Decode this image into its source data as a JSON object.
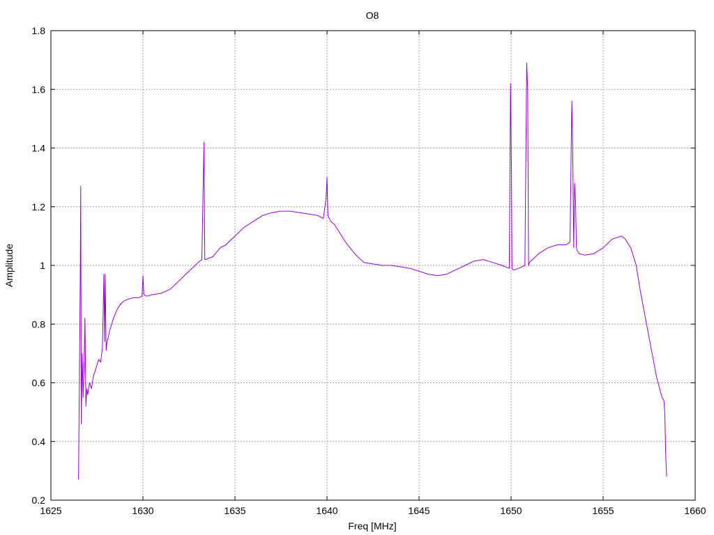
{
  "chart_data": {
    "type": "line",
    "title": "O8",
    "xlabel": "Freq [MHz]",
    "ylabel": "Amplitude",
    "xlim": [
      1625,
      1660
    ],
    "ylim": [
      0.2,
      1.8
    ],
    "xticks": [
      1625,
      1630,
      1635,
      1640,
      1645,
      1650,
      1655,
      1660
    ],
    "xtick_labels": [
      "1625",
      "1630",
      "1635",
      "1640",
      "1645",
      "1650",
      "1655",
      "1660"
    ],
    "yticks": [
      0.2,
      0.4,
      0.6,
      0.8,
      1.0,
      1.2,
      1.4,
      1.6,
      1.8
    ],
    "ytick_labels": [
      "0.2",
      "0.4",
      "0.6",
      "0.8",
      "1",
      "1.2",
      "1.4",
      "1.6",
      "1.8"
    ],
    "grid": true,
    "legend": "none",
    "series": [
      {
        "color": "#9400d3",
        "x": [
          1626.5,
          1626.55,
          1626.6,
          1626.62,
          1626.65,
          1626.7,
          1626.75,
          1626.8,
          1626.85,
          1626.9,
          1626.95,
          1627.0,
          1627.1,
          1627.2,
          1627.3,
          1627.4,
          1627.5,
          1627.6,
          1627.7,
          1627.8,
          1627.88,
          1627.92,
          1627.95,
          1628.0,
          1628.05,
          1628.1,
          1628.2,
          1628.4,
          1628.6,
          1628.8,
          1629.0,
          1629.2,
          1629.5,
          1629.8,
          1629.95,
          1630.0,
          1630.05,
          1630.2,
          1630.5,
          1631.0,
          1631.5,
          1632.0,
          1632.5,
          1633.0,
          1633.2,
          1633.28,
          1633.32,
          1633.36,
          1633.4,
          1633.8,
          1634.2,
          1634.5,
          1635.0,
          1635.5,
          1636.0,
          1636.5,
          1637.0,
          1637.5,
          1638.0,
          1638.5,
          1639.0,
          1639.5,
          1639.8,
          1639.95,
          1640.0,
          1640.05,
          1640.2,
          1640.4,
          1640.6,
          1641.0,
          1641.5,
          1642.0,
          1642.5,
          1643.0,
          1643.5,
          1644.0,
          1644.5,
          1645.0,
          1645.5,
          1646.0,
          1646.5,
          1647.0,
          1647.5,
          1648.0,
          1648.5,
          1649.0,
          1649.5,
          1649.9,
          1649.97,
          1650.02,
          1650.05,
          1650.1,
          1650.2,
          1650.4,
          1650.6,
          1650.75,
          1650.85,
          1650.9,
          1650.95,
          1651.0,
          1651.5,
          1652.0,
          1652.5,
          1653.0,
          1653.2,
          1653.3,
          1653.35,
          1653.4,
          1653.45,
          1653.5,
          1653.55,
          1653.6,
          1653.7,
          1654.0,
          1654.5,
          1655.0,
          1655.5,
          1656.0,
          1656.2,
          1656.5,
          1656.8,
          1657.0,
          1657.3,
          1657.6,
          1657.9,
          1658.2,
          1658.3,
          1658.35,
          1658.4,
          1658.45
        ],
        "y": [
          0.27,
          0.62,
          1.0,
          1.27,
          0.46,
          0.7,
          0.55,
          0.65,
          0.82,
          0.52,
          0.58,
          0.56,
          0.6,
          0.58,
          0.62,
          0.64,
          0.66,
          0.68,
          0.67,
          0.72,
          0.97,
          0.74,
          0.97,
          0.71,
          0.74,
          0.75,
          0.78,
          0.82,
          0.85,
          0.87,
          0.88,
          0.885,
          0.89,
          0.89,
          0.895,
          0.965,
          0.9,
          0.895,
          0.9,
          0.905,
          0.92,
          0.95,
          0.98,
          1.01,
          1.02,
          1.3,
          1.42,
          1.02,
          1.02,
          1.03,
          1.06,
          1.07,
          1.1,
          1.13,
          1.15,
          1.17,
          1.18,
          1.185,
          1.185,
          1.18,
          1.175,
          1.17,
          1.16,
          1.23,
          1.3,
          1.17,
          1.15,
          1.14,
          1.12,
          1.08,
          1.04,
          1.01,
          1.005,
          1.0,
          1.0,
          0.995,
          0.99,
          0.98,
          0.97,
          0.965,
          0.97,
          0.985,
          1.0,
          1.015,
          1.02,
          1.01,
          1.0,
          0.99,
          1.62,
          1.35,
          0.99,
          0.985,
          0.985,
          0.99,
          0.995,
          1.0,
          1.69,
          1.6,
          1.0,
          1.01,
          1.04,
          1.06,
          1.07,
          1.07,
          1.08,
          1.56,
          1.39,
          1.06,
          1.28,
          1.22,
          1.06,
          1.05,
          1.04,
          1.035,
          1.04,
          1.06,
          1.09,
          1.1,
          1.09,
          1.06,
          1.0,
          0.92,
          0.82,
          0.72,
          0.62,
          0.55,
          0.54,
          0.5,
          0.35,
          0.28
        ]
      }
    ]
  }
}
